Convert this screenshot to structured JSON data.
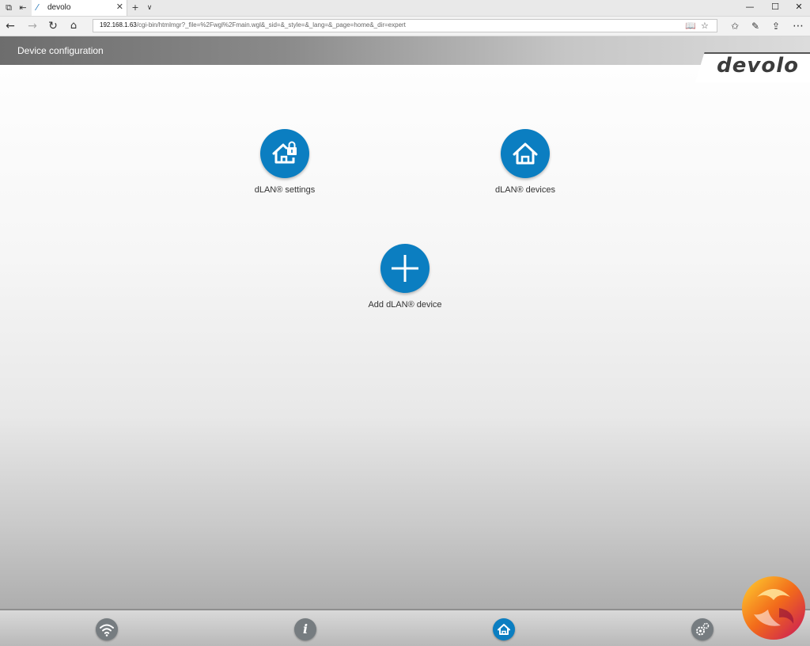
{
  "browser": {
    "tab_title": "devolo",
    "url_host": "192.168.1.63",
    "url_path": "/cgi-bin/htmlmgr?_file=%2Fwgl%2Fmain.wgl&_sid=&_style=&_lang=&_page=home&_dir=expert",
    "new_tab_glyph": "+",
    "tab_list_glyph": "∨",
    "tab_close_glyph": "✕",
    "window_minimize_glyph": "—",
    "window_maximize_glyph": "☐",
    "window_close_glyph": "✕"
  },
  "header": {
    "title": "Device configuration",
    "logo": "devolo"
  },
  "tiles": [
    {
      "label": "dLAN® settings",
      "icon": "home-lock-icon"
    },
    {
      "label": "dLAN® devices",
      "icon": "home-icon"
    },
    {
      "label": "Add dLAN® device",
      "icon": "plus-icon"
    }
  ],
  "footer": {
    "buttons": [
      {
        "name": "wifi",
        "icon": "wifi-icon",
        "active": false
      },
      {
        "name": "info",
        "icon": "info-icon",
        "glyph": "i",
        "active": false
      },
      {
        "name": "home",
        "icon": "home-icon",
        "active": true
      },
      {
        "name": "settings",
        "icon": "gear-icon",
        "active": false
      }
    ]
  },
  "colors": {
    "accent": "#0b7ec1",
    "footer_button": "#767c80"
  }
}
